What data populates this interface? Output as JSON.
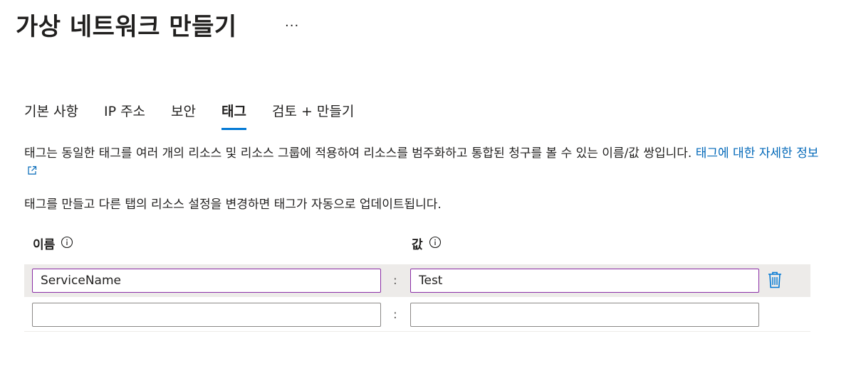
{
  "header": {
    "title": "가상 네트워크 만들기",
    "more_label": "···"
  },
  "tabs": [
    {
      "label": "기본 사항",
      "active": false
    },
    {
      "label": "IP 주소",
      "active": false
    },
    {
      "label": "보안",
      "active": false
    },
    {
      "label": "태그",
      "active": true
    },
    {
      "label": "검토 + 만들기",
      "active": false
    }
  ],
  "description": {
    "text": "태그는 동일한 태그를 여러 개의 리소스 및 리소스 그룹에 적용하여 리소스를 범주화하고 통합된 청구를 볼 수 있는 이름/값 쌍입니다. ",
    "link_label": "태그에 대한 자세한 정보",
    "link_icon": "external-link-icon",
    "note": "태그를 만들고 다른 탭의 리소스 설정을 변경하면 태그가 자동으로 업데이트됩니다."
  },
  "table": {
    "name_header": "이름",
    "value_header": "값",
    "info_icon": "info-icon",
    "separator": ":",
    "rows": [
      {
        "name": "ServiceName",
        "value": "Test",
        "delete_icon": "trash-icon"
      },
      {
        "name": "",
        "value": ""
      }
    ]
  },
  "colors": {
    "accent": "#0078d4",
    "link": "#0067b8",
    "focus_border": "#8a2da5",
    "row_hover": "#edebe9"
  }
}
